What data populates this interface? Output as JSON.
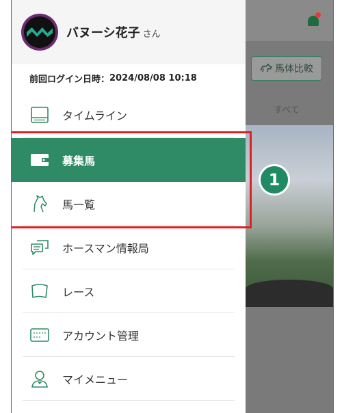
{
  "background": {
    "compare_button": "馬体比較",
    "tab_all": "すべて",
    "callout_number": "1"
  },
  "drawer": {
    "user": {
      "name": "バヌーシ花子",
      "suffix": "さん"
    },
    "last_login": {
      "label": "前回ログイン日時：",
      "datetime": "2024/08/08 10:18"
    },
    "menu": [
      {
        "label": "タイムライン",
        "icon": "timeline-icon",
        "active": false
      },
      {
        "label": "募集馬",
        "icon": "wallet-icon",
        "active": true
      },
      {
        "label": "馬一覧",
        "icon": "horse-icon",
        "active": false
      },
      {
        "label": "ホースマン情報局",
        "icon": "chat-icon",
        "active": false
      },
      {
        "label": "レース",
        "icon": "flag-icon",
        "active": false
      },
      {
        "label": "アカウント管理",
        "icon": "card-icon",
        "active": false
      },
      {
        "label": "マイメニュー",
        "icon": "user-icon",
        "active": false
      }
    ]
  },
  "colors": {
    "accent": "#2e8b65",
    "highlight": "#e02020",
    "notification": "#e53935"
  }
}
